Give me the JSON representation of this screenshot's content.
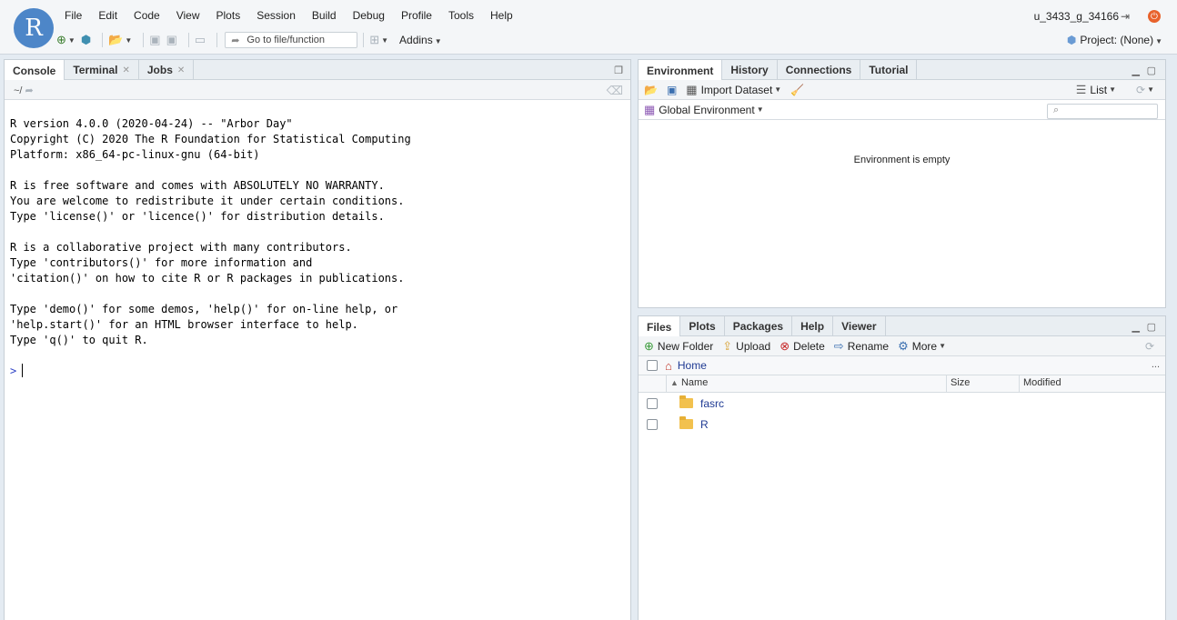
{
  "logo": {
    "letter": "R"
  },
  "menu": [
    "File",
    "Edit",
    "Code",
    "View",
    "Plots",
    "Session",
    "Build",
    "Debug",
    "Profile",
    "Tools",
    "Help"
  ],
  "user": {
    "name": "u_3433_g_34166"
  },
  "toolbar": {
    "goto_placeholder": "Go to file/function",
    "addins_label": "Addins"
  },
  "project": {
    "label": "Project: (None)"
  },
  "console_pane": {
    "tabs": [
      {
        "label": "Console",
        "closable": false
      },
      {
        "label": "Terminal",
        "closable": true
      },
      {
        "label": "Jobs",
        "closable": true
      }
    ],
    "path": "~/",
    "output": "R version 4.0.0 (2020-04-24) -- \"Arbor Day\"\nCopyright (C) 2020 The R Foundation for Statistical Computing\nPlatform: x86_64-pc-linux-gnu (64-bit)\n\nR is free software and comes with ABSOLUTELY NO WARRANTY.\nYou are welcome to redistribute it under certain conditions.\nType 'license()' or 'licence()' for distribution details.\n\nR is a collaborative project with many contributors.\nType 'contributors()' for more information and\n'citation()' on how to cite R or R packages in publications.\n\nType 'demo()' for some demos, 'help()' for on-line help, or\n'help.start()' for an HTML browser interface to help.\nType 'q()' to quit R.",
    "prompt": ">"
  },
  "env_pane": {
    "tabs": [
      "Environment",
      "History",
      "Connections",
      "Tutorial"
    ],
    "import_label": "Import Dataset",
    "view_mode": "List",
    "scope": "Global Environment",
    "empty_message": "Environment is empty"
  },
  "files_pane": {
    "tabs": [
      "Files",
      "Plots",
      "Packages",
      "Help",
      "Viewer"
    ],
    "actions": {
      "new_folder": "New Folder",
      "upload": "Upload",
      "delete": "Delete",
      "rename": "Rename",
      "more": "More"
    },
    "breadcrumb": "Home",
    "more_dots": "...",
    "columns": {
      "name": "Name",
      "size": "Size",
      "modified": "Modified"
    },
    "rows": [
      {
        "name": "fasrc",
        "size": "",
        "modified": ""
      },
      {
        "name": "R",
        "size": "",
        "modified": ""
      }
    ]
  },
  "colors": {
    "accent": "#4d86c8",
    "link": "#1f3a93",
    "prompt": "#2f43c6"
  }
}
